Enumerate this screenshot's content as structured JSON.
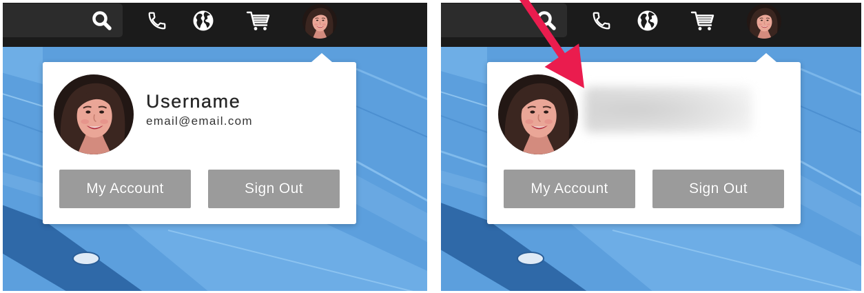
{
  "colors": {
    "navbar_bg": "#1b1b1b",
    "search_bg": "#2c2c2c",
    "page_bg": "#5c9fdd",
    "card_bg": "#ffffff",
    "button_bg": "#9b9b9b",
    "button_text": "#ffffff",
    "text_dark": "#262626",
    "chevron": "#b0b0b0",
    "annotation_arrow": "#ea1c4e"
  },
  "panels": [
    {
      "navbar": {
        "icons": [
          "search-icon",
          "phone-icon",
          "globe-icon",
          "chevron-down-icon",
          "cart-icon",
          "chevron-down-icon",
          "avatar",
          "chevron-down-icon"
        ]
      },
      "popup": {
        "username": "Username",
        "email": "email@email.com",
        "my_account_label": "My Account",
        "sign_out_label": "Sign Out"
      }
    },
    {
      "navbar": {
        "icons": [
          "search-icon",
          "phone-icon",
          "globe-icon",
          "chevron-down-icon",
          "cart-icon",
          "chevron-down-icon",
          "avatar",
          "chevron-down-icon"
        ]
      },
      "popup": {
        "identity_blurred": true,
        "my_account_label": "My Account",
        "sign_out_label": "Sign Out"
      }
    }
  ]
}
